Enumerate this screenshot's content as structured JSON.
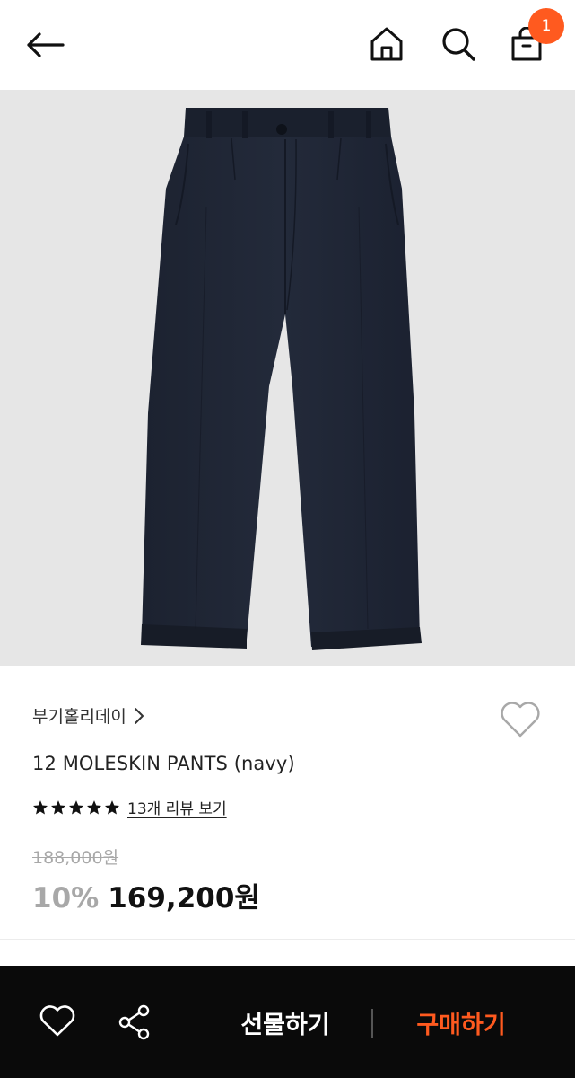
{
  "header": {
    "back_icon": "arrow-left-icon",
    "home_icon": "home-icon",
    "search_icon": "search-icon",
    "cart_icon": "shopping-bag-icon",
    "cart_badge": "1",
    "badge_color": "#ff5a1f"
  },
  "product": {
    "image_alt_icon": "pants-photo",
    "brand": "부기홀리데이",
    "title": "12 MOLESKIN PANTS (navy)",
    "rating_stars": 5,
    "review_link": "13개 리뷰 보기",
    "original_price": "188,000원",
    "discount": "10%",
    "sale_price": "169,200원"
  },
  "bottom_bar": {
    "gift_label": "선물하기",
    "buy_label": "구매하기",
    "accent": "#ff5a1f"
  }
}
